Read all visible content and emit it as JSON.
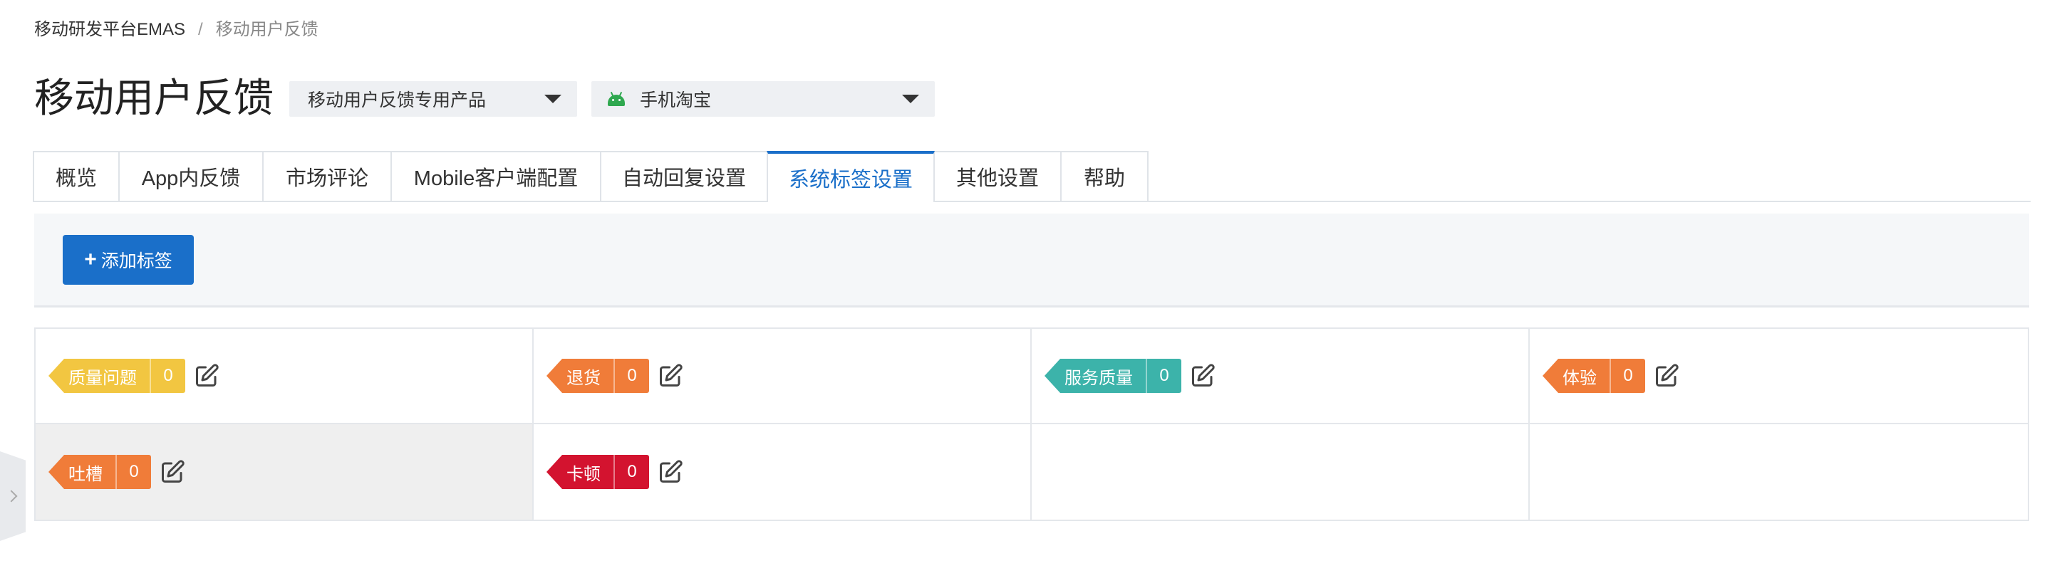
{
  "breadcrumb": {
    "root": "移动研发平台EMAS",
    "separator": "/",
    "current": "移动用户反馈"
  },
  "header": {
    "title": "移动用户反馈",
    "product_select": {
      "value": "移动用户反馈专用产品",
      "icon": "chevron-down-icon"
    },
    "app_select": {
      "value": "手机淘宝",
      "platform_icon": "android-icon",
      "icon": "chevron-down-icon"
    }
  },
  "tabs": [
    {
      "label": "概览",
      "active": false
    },
    {
      "label": "App内反馈",
      "active": false
    },
    {
      "label": "市场评论",
      "active": false
    },
    {
      "label": "Mobile客户端配置",
      "active": false
    },
    {
      "label": "自动回复设置",
      "active": false
    },
    {
      "label": "系统标签设置",
      "active": true
    },
    {
      "label": "其他设置",
      "active": false
    },
    {
      "label": "帮助",
      "active": false
    }
  ],
  "toolbar": {
    "add_tag_label": "添加标签",
    "add_icon": "+"
  },
  "tags": [
    {
      "name": "质量问题",
      "count": "0",
      "color": "#f2c641"
    },
    {
      "name": "退货",
      "count": "0",
      "color": "#f07c39"
    },
    {
      "name": "服务质量",
      "count": "0",
      "color": "#3cb3aa"
    },
    {
      "name": "体验",
      "count": "0",
      "color": "#f07c39"
    },
    {
      "name": "吐槽",
      "count": "0",
      "color": "#f07c39"
    },
    {
      "name": "卡顿",
      "count": "0",
      "color": "#d3132f"
    }
  ],
  "colors": {
    "accent": "#1a6fc9",
    "tab_border": "#dfe3e8",
    "toolbar_bg": "#f5f7f9"
  }
}
